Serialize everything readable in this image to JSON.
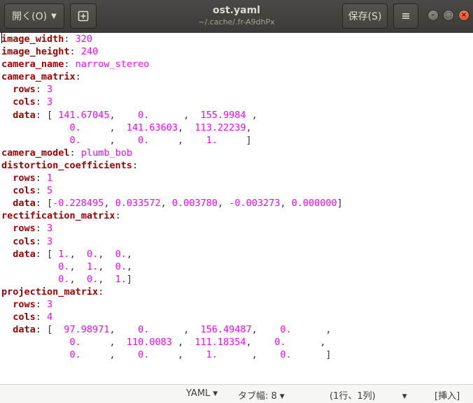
{
  "titlebar": {
    "open_label": "開く(O)",
    "save_label": "保存(S)",
    "title": "ost.yaml",
    "subtitle": "~/.cache/.fr-A9dhPx",
    "icons": {
      "open_dropdown": "chevron-down-icon",
      "new_tab": "new-document-icon",
      "menu": "hamburger-menu-icon",
      "minimize": "minimize-icon",
      "maximize": "maximize-icon",
      "close": "close-icon"
    },
    "colors": {
      "bar": "#3c3b37",
      "close_button": "#e4532a",
      "text": "#dfdbd2"
    }
  },
  "editor": {
    "syntax_colors": {
      "key": "#a40000",
      "value": "#ff00ff",
      "punctuation": "#2e3436"
    },
    "lines": [
      [
        {
          "t": "k",
          "s": "image_width"
        },
        {
          "t": "p",
          "s": ": "
        },
        {
          "t": "v",
          "s": "320"
        }
      ],
      [
        {
          "t": "k",
          "s": "image_height"
        },
        {
          "t": "p",
          "s": ": "
        },
        {
          "t": "v",
          "s": "240"
        }
      ],
      [
        {
          "t": "k",
          "s": "camera_name"
        },
        {
          "t": "p",
          "s": ": "
        },
        {
          "t": "v",
          "s": "narrow_stereo"
        }
      ],
      [
        {
          "t": "k",
          "s": "camera_matrix"
        },
        {
          "t": "p",
          "s": ":"
        }
      ],
      [
        {
          "t": "p",
          "s": "  "
        },
        {
          "t": "k",
          "s": "rows"
        },
        {
          "t": "p",
          "s": ": "
        },
        {
          "t": "v",
          "s": "3"
        }
      ],
      [
        {
          "t": "p",
          "s": "  "
        },
        {
          "t": "k",
          "s": "cols"
        },
        {
          "t": "p",
          "s": ": "
        },
        {
          "t": "v",
          "s": "3"
        }
      ],
      [
        {
          "t": "p",
          "s": "  "
        },
        {
          "t": "k",
          "s": "data"
        },
        {
          "t": "p",
          "s": ": [ "
        },
        {
          "t": "v",
          "s": "141.67045"
        },
        {
          "t": "p",
          "s": ",    "
        },
        {
          "t": "v",
          "s": "0."
        },
        {
          "t": "p",
          "s": "      ,  "
        },
        {
          "t": "v",
          "s": "155.9984"
        },
        {
          "t": "p",
          "s": " ,"
        }
      ],
      [
        {
          "t": "p",
          "s": "            "
        },
        {
          "t": "v",
          "s": "0."
        },
        {
          "t": "p",
          "s": "     ,  "
        },
        {
          "t": "v",
          "s": "141.63603"
        },
        {
          "t": "p",
          "s": ",  "
        },
        {
          "t": "v",
          "s": "113.22239"
        },
        {
          "t": "p",
          "s": ","
        }
      ],
      [
        {
          "t": "p",
          "s": "            "
        },
        {
          "t": "v",
          "s": "0."
        },
        {
          "t": "p",
          "s": "     ,    "
        },
        {
          "t": "v",
          "s": "0."
        },
        {
          "t": "p",
          "s": "     ,    "
        },
        {
          "t": "v",
          "s": "1."
        },
        {
          "t": "p",
          "s": "     ]"
        }
      ],
      [
        {
          "t": "k",
          "s": "camera_model"
        },
        {
          "t": "p",
          "s": ": "
        },
        {
          "t": "v",
          "s": "plumb_bob"
        }
      ],
      [
        {
          "t": "k",
          "s": "distortion_coefficients"
        },
        {
          "t": "p",
          "s": ":"
        }
      ],
      [
        {
          "t": "p",
          "s": "  "
        },
        {
          "t": "k",
          "s": "rows"
        },
        {
          "t": "p",
          "s": ": "
        },
        {
          "t": "v",
          "s": "1"
        }
      ],
      [
        {
          "t": "p",
          "s": "  "
        },
        {
          "t": "k",
          "s": "cols"
        },
        {
          "t": "p",
          "s": ": "
        },
        {
          "t": "v",
          "s": "5"
        }
      ],
      [
        {
          "t": "p",
          "s": "  "
        },
        {
          "t": "k",
          "s": "data"
        },
        {
          "t": "p",
          "s": ": ["
        },
        {
          "t": "v",
          "s": "-0.228495"
        },
        {
          "t": "p",
          "s": ", "
        },
        {
          "t": "v",
          "s": "0.033572"
        },
        {
          "t": "p",
          "s": ", "
        },
        {
          "t": "v",
          "s": "0.003780"
        },
        {
          "t": "p",
          "s": ", "
        },
        {
          "t": "v",
          "s": "-0.003273"
        },
        {
          "t": "p",
          "s": ", "
        },
        {
          "t": "v",
          "s": "0.000000"
        },
        {
          "t": "p",
          "s": "]"
        }
      ],
      [
        {
          "t": "k",
          "s": "rectification_matrix"
        },
        {
          "t": "p",
          "s": ":"
        }
      ],
      [
        {
          "t": "p",
          "s": "  "
        },
        {
          "t": "k",
          "s": "rows"
        },
        {
          "t": "p",
          "s": ": "
        },
        {
          "t": "v",
          "s": "3"
        }
      ],
      [
        {
          "t": "p",
          "s": "  "
        },
        {
          "t": "k",
          "s": "cols"
        },
        {
          "t": "p",
          "s": ": "
        },
        {
          "t": "v",
          "s": "3"
        }
      ],
      [
        {
          "t": "p",
          "s": "  "
        },
        {
          "t": "k",
          "s": "data"
        },
        {
          "t": "p",
          "s": ": [ "
        },
        {
          "t": "v",
          "s": "1."
        },
        {
          "t": "p",
          "s": ",  "
        },
        {
          "t": "v",
          "s": "0."
        },
        {
          "t": "p",
          "s": ",  "
        },
        {
          "t": "v",
          "s": "0."
        },
        {
          "t": "p",
          "s": ","
        }
      ],
      [
        {
          "t": "p",
          "s": "          "
        },
        {
          "t": "v",
          "s": "0."
        },
        {
          "t": "p",
          "s": ",  "
        },
        {
          "t": "v",
          "s": "1."
        },
        {
          "t": "p",
          "s": ",  "
        },
        {
          "t": "v",
          "s": "0."
        },
        {
          "t": "p",
          "s": ","
        }
      ],
      [
        {
          "t": "p",
          "s": "          "
        },
        {
          "t": "v",
          "s": "0."
        },
        {
          "t": "p",
          "s": ",  "
        },
        {
          "t": "v",
          "s": "0."
        },
        {
          "t": "p",
          "s": ",  "
        },
        {
          "t": "v",
          "s": "1."
        },
        {
          "t": "p",
          "s": "]"
        }
      ],
      [
        {
          "t": "k",
          "s": "projection_matrix"
        },
        {
          "t": "p",
          "s": ":"
        }
      ],
      [
        {
          "t": "p",
          "s": "  "
        },
        {
          "t": "k",
          "s": "rows"
        },
        {
          "t": "p",
          "s": ": "
        },
        {
          "t": "v",
          "s": "3"
        }
      ],
      [
        {
          "t": "p",
          "s": "  "
        },
        {
          "t": "k",
          "s": "cols"
        },
        {
          "t": "p",
          "s": ": "
        },
        {
          "t": "v",
          "s": "4"
        }
      ],
      [
        {
          "t": "p",
          "s": "  "
        },
        {
          "t": "k",
          "s": "data"
        },
        {
          "t": "p",
          "s": ": [  "
        },
        {
          "t": "v",
          "s": "97.98971"
        },
        {
          "t": "p",
          "s": ",    "
        },
        {
          "t": "v",
          "s": "0."
        },
        {
          "t": "p",
          "s": "      ,  "
        },
        {
          "t": "v",
          "s": "156.49487"
        },
        {
          "t": "p",
          "s": ",    "
        },
        {
          "t": "v",
          "s": "0."
        },
        {
          "t": "p",
          "s": "      ,"
        }
      ],
      [
        {
          "t": "p",
          "s": "            "
        },
        {
          "t": "v",
          "s": "0."
        },
        {
          "t": "p",
          "s": "     ,  "
        },
        {
          "t": "v",
          "s": "110.0083"
        },
        {
          "t": "p",
          "s": " ,  "
        },
        {
          "t": "v",
          "s": "111.18354"
        },
        {
          "t": "p",
          "s": ",    "
        },
        {
          "t": "v",
          "s": "0."
        },
        {
          "t": "p",
          "s": "      ,"
        }
      ],
      [
        {
          "t": "p",
          "s": "            "
        },
        {
          "t": "v",
          "s": "0."
        },
        {
          "t": "p",
          "s": "     ,    "
        },
        {
          "t": "v",
          "s": "0."
        },
        {
          "t": "p",
          "s": "     ,    "
        },
        {
          "t": "v",
          "s": "1."
        },
        {
          "t": "p",
          "s": "      ,    "
        },
        {
          "t": "v",
          "s": "0."
        },
        {
          "t": "p",
          "s": "      ]"
        }
      ]
    ]
  },
  "statusbar": {
    "language": "YAML",
    "tab_width": "タブ幅: 8",
    "cursor_position": "(1行、1列)",
    "insert_mode": "[挿入]"
  }
}
